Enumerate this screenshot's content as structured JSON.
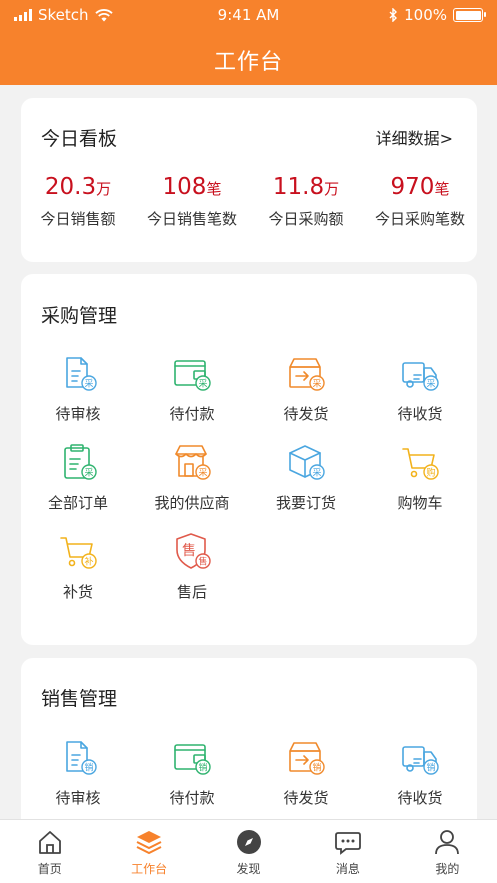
{
  "status_bar": {
    "carrier": "Sketch",
    "time": "9:41 AM",
    "battery": "100%",
    "battery_level": 1.0
  },
  "header": {
    "title": "工作台"
  },
  "dashboard": {
    "title": "今日看板",
    "more_link": "详细数据>",
    "stats": [
      {
        "value": "20.3",
        "unit": "万",
        "label": "今日销售额"
      },
      {
        "value": "108",
        "unit": "笔",
        "label": "今日销售笔数"
      },
      {
        "value": "11.8",
        "unit": "万",
        "label": "今日采购额"
      },
      {
        "value": "970",
        "unit": "笔",
        "label": "今日采购笔数"
      }
    ]
  },
  "purchase": {
    "title": "采购管理",
    "items": [
      {
        "label": "待审核",
        "icon": "document-review-icon",
        "badge": "采",
        "color": "#4aa6e0"
      },
      {
        "label": "待付款",
        "icon": "wallet-icon",
        "badge": "采",
        "color": "#2fb36f"
      },
      {
        "label": "待发货",
        "icon": "ship-box-icon",
        "badge": "采",
        "color": "#f08a2c"
      },
      {
        "label": "待收货",
        "icon": "truck-icon",
        "badge": "采",
        "color": "#4aa6e0"
      },
      {
        "label": "全部订单",
        "icon": "clipboard-icon",
        "badge": "采",
        "color": "#2fb36f"
      },
      {
        "label": "我的供应商",
        "icon": "store-icon",
        "badge": "采",
        "color": "#f08a2c"
      },
      {
        "label": "我要订货",
        "icon": "package-icon",
        "badge": "采",
        "color": "#4aa6e0"
      },
      {
        "label": "购物车",
        "icon": "cart-icon",
        "badge": "购",
        "color": "#f2b21b"
      },
      {
        "label": "补货",
        "icon": "restock-cart-icon",
        "badge": "补",
        "color": "#f2b21b"
      },
      {
        "label": "售后",
        "icon": "after-sales-shield-icon",
        "badge": "售",
        "color": "#e05a4b"
      }
    ]
  },
  "sales": {
    "title": "销售管理",
    "items": [
      {
        "label": "待审核",
        "icon": "document-review-icon",
        "badge": "销",
        "color": "#4aa6e0"
      },
      {
        "label": "待付款",
        "icon": "wallet-icon",
        "badge": "销",
        "color": "#2fb36f"
      },
      {
        "label": "待发货",
        "icon": "ship-box-icon",
        "badge": "销",
        "color": "#f08a2c"
      },
      {
        "label": "待收货",
        "icon": "truck-icon",
        "badge": "销",
        "color": "#4aa6e0"
      }
    ]
  },
  "tabs": [
    {
      "label": "首页",
      "icon": "home-icon"
    },
    {
      "label": "工作台",
      "icon": "layers-icon",
      "active": true
    },
    {
      "label": "发现",
      "icon": "compass-icon"
    },
    {
      "label": "消息",
      "icon": "chat-icon"
    },
    {
      "label": "我的",
      "icon": "user-icon"
    }
  ],
  "colors": {
    "accent": "#f7822c",
    "stat_value": "#c8101e"
  }
}
